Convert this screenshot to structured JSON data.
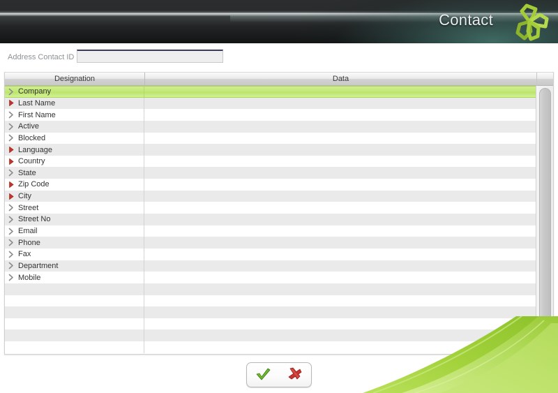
{
  "header": {
    "title": "Contact",
    "logo_icon": "clover-logo-icon",
    "accent_color": "#a4cc39",
    "bar_color": "#1c1e1f"
  },
  "id_row": {
    "label": "Address Contact ID",
    "value": "",
    "placeholder": ""
  },
  "grid": {
    "columns": [
      {
        "key": "designation",
        "label": "Designation"
      },
      {
        "key": "data",
        "label": "Data"
      }
    ],
    "selected_index": 0,
    "required_marker": "red-triangle-icon",
    "optional_marker": "chevron-right-icon",
    "edit_icon": "pencil-edit-icon",
    "rows": [
      {
        "designation": "Company",
        "data": "",
        "required": false,
        "selected": true
      },
      {
        "designation": "Last Name",
        "data": "",
        "required": true,
        "selected": false
      },
      {
        "designation": "First Name",
        "data": "",
        "required": false,
        "selected": false
      },
      {
        "designation": "Active",
        "data": "",
        "required": false,
        "selected": false
      },
      {
        "designation": "Blocked",
        "data": "",
        "required": false,
        "selected": false
      },
      {
        "designation": "Language",
        "data": "",
        "required": true,
        "selected": false
      },
      {
        "designation": "Country",
        "data": "",
        "required": true,
        "selected": false
      },
      {
        "designation": "State",
        "data": "",
        "required": false,
        "selected": false
      },
      {
        "designation": "Zip Code",
        "data": "",
        "required": true,
        "selected": false
      },
      {
        "designation": "City",
        "data": "",
        "required": true,
        "selected": false
      },
      {
        "designation": "Street",
        "data": "",
        "required": false,
        "selected": false
      },
      {
        "designation": "Street No",
        "data": "",
        "required": false,
        "selected": false
      },
      {
        "designation": "Email",
        "data": "",
        "required": false,
        "selected": false
      },
      {
        "designation": "Phone",
        "data": "",
        "required": false,
        "selected": false
      },
      {
        "designation": "Fax",
        "data": "",
        "required": false,
        "selected": false
      },
      {
        "designation": "Department",
        "data": "",
        "required": false,
        "selected": false
      },
      {
        "designation": "Mobile",
        "data": "",
        "required": false,
        "selected": false
      }
    ],
    "empty_row_count": 6,
    "selected_row_color": "#c2e876",
    "alt_row_color": "#eaeaea"
  },
  "scrollbar": {
    "orientation": "vertical",
    "thumb_name": "scroll-thumb"
  },
  "footer": {
    "confirm_icon": "green-check-icon",
    "cancel_icon": "red-x-icon",
    "confirm_color": "#5aa823",
    "cancel_color": "#c8352f"
  },
  "decoration": {
    "swoosh_name": "green-swoosh-graphic",
    "swoosh_color": "#a8d83f"
  }
}
